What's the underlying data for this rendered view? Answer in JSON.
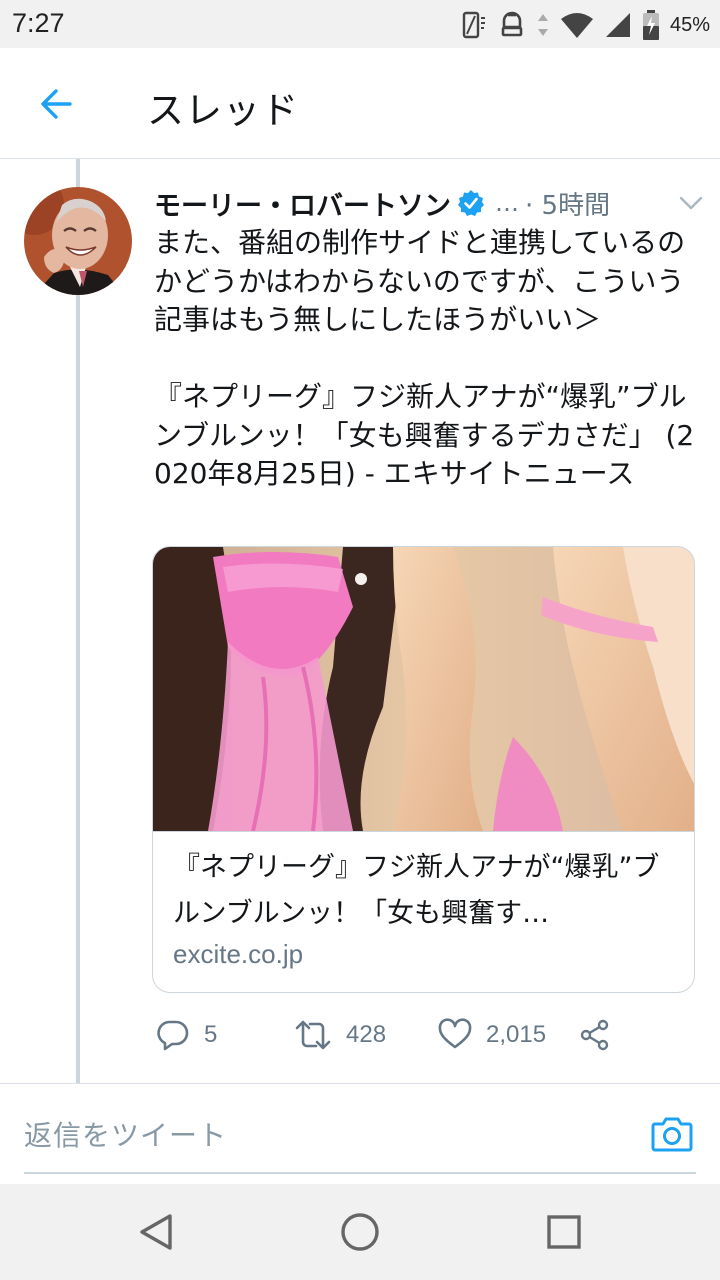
{
  "status_bar": {
    "time": "7:27",
    "battery": "45%"
  },
  "header": {
    "title": "スレッド"
  },
  "tweet": {
    "name": "モーリー・ロバートソン",
    "handle_truncated": "…",
    "time": "· 5時間",
    "text": "また、番組の制作サイドと連携しているのかどうかはわからないのですが、こういう記事はもう無しにしたほうがいい＞\n\n『ネプリーグ』フジ新人アナが“爆乳”ブルンブルンッ！「女も興奮するデカさだ」 (2020年8月25日) - エキサイトニュース",
    "card": {
      "title": "『ネプリーグ』フジ新人アナが“爆乳”ブルンブルンッ！「女も興奮す…",
      "domain": "excite.co.jp"
    },
    "actions": {
      "replies": "5",
      "retweets": "428",
      "likes": "2,015"
    }
  },
  "reply": {
    "placeholder": "返信をツイート"
  },
  "colors": {
    "accent": "#1da1f2",
    "secondary_text": "#657786",
    "border": "#ccd6dd"
  },
  "icons": [
    "back-arrow-icon",
    "verified-icon",
    "chevron-down-icon",
    "reply-icon",
    "retweet-icon",
    "like-icon",
    "share-icon",
    "camera-icon",
    "nav-back-icon",
    "nav-home-icon",
    "nav-recents-icon"
  ]
}
